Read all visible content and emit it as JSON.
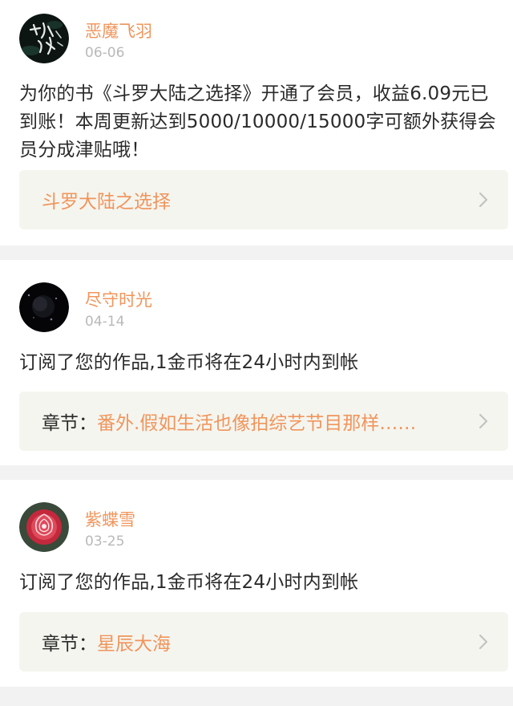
{
  "theme": {
    "accent": "#f0955c",
    "text": "#2a2a2a",
    "muted": "#b9b9b9",
    "box_bg": "#f5f5ef",
    "page_bg": "#f2f2f2"
  },
  "messages": [
    {
      "user": "恶魔飞羽",
      "date": "06-06",
      "avatar_icon": "calligraphy-avatar-icon",
      "text": "为你的书《斗罗大陆之选择》开通了会员，收益6.09元已到账！本周更新达到5000/10000/15000字可额外获得会员分成津贴哦！",
      "link": {
        "prefix": "",
        "title": "斗罗大陆之选择"
      }
    },
    {
      "user": "尽守时光",
      "date": "04-14",
      "avatar_icon": "dark-moon-avatar-icon",
      "text": "订阅了您的作品,1金币将在24小时内到帐",
      "link": {
        "prefix": "章节：",
        "title": "番外.假如生活也像拍综艺节目那样……"
      }
    },
    {
      "user": "紫蝶雪",
      "date": "03-25",
      "avatar_icon": "rose-avatar-icon",
      "text": "订阅了您的作品,1金币将在24小时内到帐",
      "link": {
        "prefix": "章节：",
        "title": "星辰大海"
      }
    }
  ]
}
